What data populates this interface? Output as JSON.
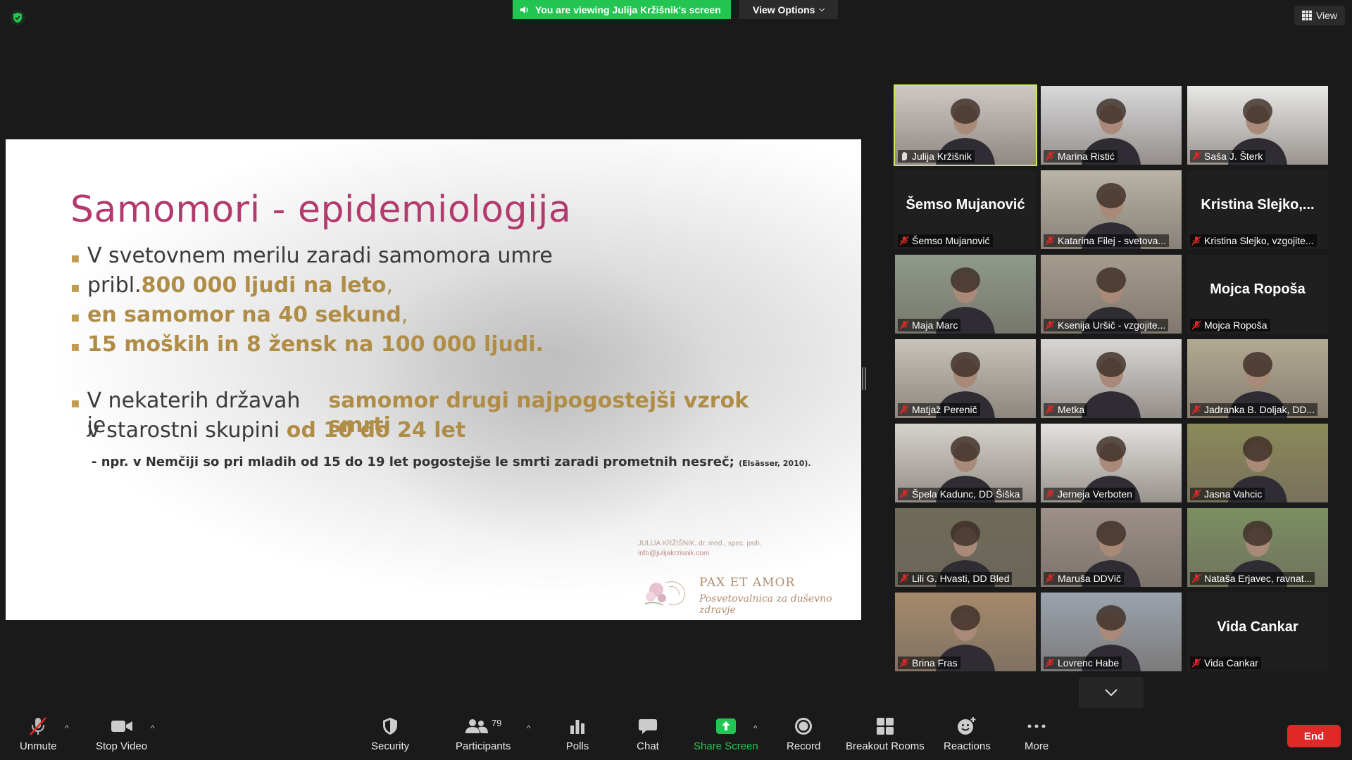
{
  "top": {
    "banner_text": "You are viewing Julija Kržišnik's screen",
    "view_options_label": "View Options",
    "view_label": "View"
  },
  "slide": {
    "title": "Samomori - epidemiologija",
    "b1": "V svetovnem merilu zaradi samomora umre",
    "b2_pre": "pribl. ",
    "b2_gold": "800 000 ljudi na leto",
    "b2_post": ",",
    "b3_gold": "en samomor na 40 sekund",
    "b3_post": ",",
    "b4_gold": "15 moških in 8 žensk na 100 000 ljudi.",
    "b5_pre": "V nekaterih državah je ",
    "b5_gold": "samomor drugi najpogostejši vzrok smrti",
    "b6_pre": "v starostni skupini ",
    "b6_gold": "od 10 do 24 let",
    "note": "- npr.  v Nemčiji so pri mladih od 15 do 19 let pogostejše le smrti zaradi prometnih nesreč;",
    "note_cite": "(Elsässer, 2010).",
    "author": "JULIJA KRŽIŠNIK, dr. med., spec. psih.",
    "email": "info@julijakrzisnik.com",
    "brand": "PAX ET AMOR",
    "brand_sub": "Posvetovalnica za duševno zdravje"
  },
  "gallery": [
    {
      "label": "Julija Kržišnik",
      "big": "",
      "photo": "person",
      "bg": "#cfc8c4",
      "active": true
    },
    {
      "label": "Marina Ristić",
      "big": "",
      "photo": "person",
      "bg": "#d9d9db"
    },
    {
      "label": "Saša J. Šterk",
      "big": "",
      "photo": "person",
      "bg": "#e8e8e6"
    },
    {
      "label": "Šemso Mujanović",
      "big": "Šemso Mujanović",
      "photo": "none",
      "bg": "#1f1f1f"
    },
    {
      "label": "Katarina Filej - svetova...",
      "big": "",
      "photo": "person",
      "bg": "#b9b4a6"
    },
    {
      "label": "Kristina Slejko, vzgojite...",
      "big": "Kristina  Slejko,...",
      "photo": "none",
      "bg": "#1f1f1f"
    },
    {
      "label": "Maja Marc",
      "big": "",
      "photo": "person",
      "bg": "#8e9a8a"
    },
    {
      "label": "Ksenija Uršič - vzgojite...",
      "big": "",
      "photo": "person",
      "bg": "#a59c8e"
    },
    {
      "label": "Mojca Ropoša",
      "big": "Mojca Ropoša",
      "photo": "none",
      "bg": "#1f1f1f"
    },
    {
      "label": "Matjaž Perenič",
      "big": "",
      "photo": "person",
      "bg": "#c8c3bb"
    },
    {
      "label": "Metka",
      "big": "",
      "photo": "person",
      "bg": "#d8d6d4"
    },
    {
      "label": "Jadranka B. Doljak, DD...",
      "big": "",
      "photo": "person",
      "bg": "#b3aa92"
    },
    {
      "label": "Špela Kadunc, DD Šiška",
      "big": "",
      "photo": "person",
      "bg": "#d6d2cc"
    },
    {
      "label": "Jerneja Verboten",
      "big": "",
      "photo": "person",
      "bg": "#e4e2df"
    },
    {
      "label": "Jasna Vahcic",
      "big": "",
      "photo": "person",
      "bg": "#8b8a5a"
    },
    {
      "label": "Lili G. Hvasti, DD Bled",
      "big": "",
      "photo": "person",
      "bg": "#6e6b58"
    },
    {
      "label": "Maruša DDVič",
      "big": "",
      "photo": "person",
      "bg": "#9c9088"
    },
    {
      "label": "Nataša Erjavec, ravnat...",
      "big": "",
      "photo": "person",
      "bg": "#7b8f62"
    },
    {
      "label": "Brina Fras",
      "big": "",
      "photo": "person",
      "bg": "#a58a6c"
    },
    {
      "label": "Lovrenc Habe",
      "big": "",
      "photo": "person",
      "bg": "#9aa3ad"
    },
    {
      "label": "Vida Cankar",
      "big": "Vida Cankar",
      "photo": "none",
      "bg": "#1f1f1f"
    }
  ],
  "toolbar": {
    "unmute": "Unmute",
    "stop_video": "Stop Video",
    "security": "Security",
    "participants": "Participants",
    "participants_count": "79",
    "polls": "Polls",
    "chat": "Chat",
    "share_screen": "Share Screen",
    "record": "Record",
    "breakout_rooms": "Breakout Rooms",
    "reactions": "Reactions",
    "more": "More",
    "end": "End"
  },
  "colors": {
    "accent_green": "#23c552",
    "end_red": "#e02828",
    "slide_title": "#b23a6e",
    "slide_gold": "#b08d46",
    "active_speaker": "#c7e85a"
  }
}
